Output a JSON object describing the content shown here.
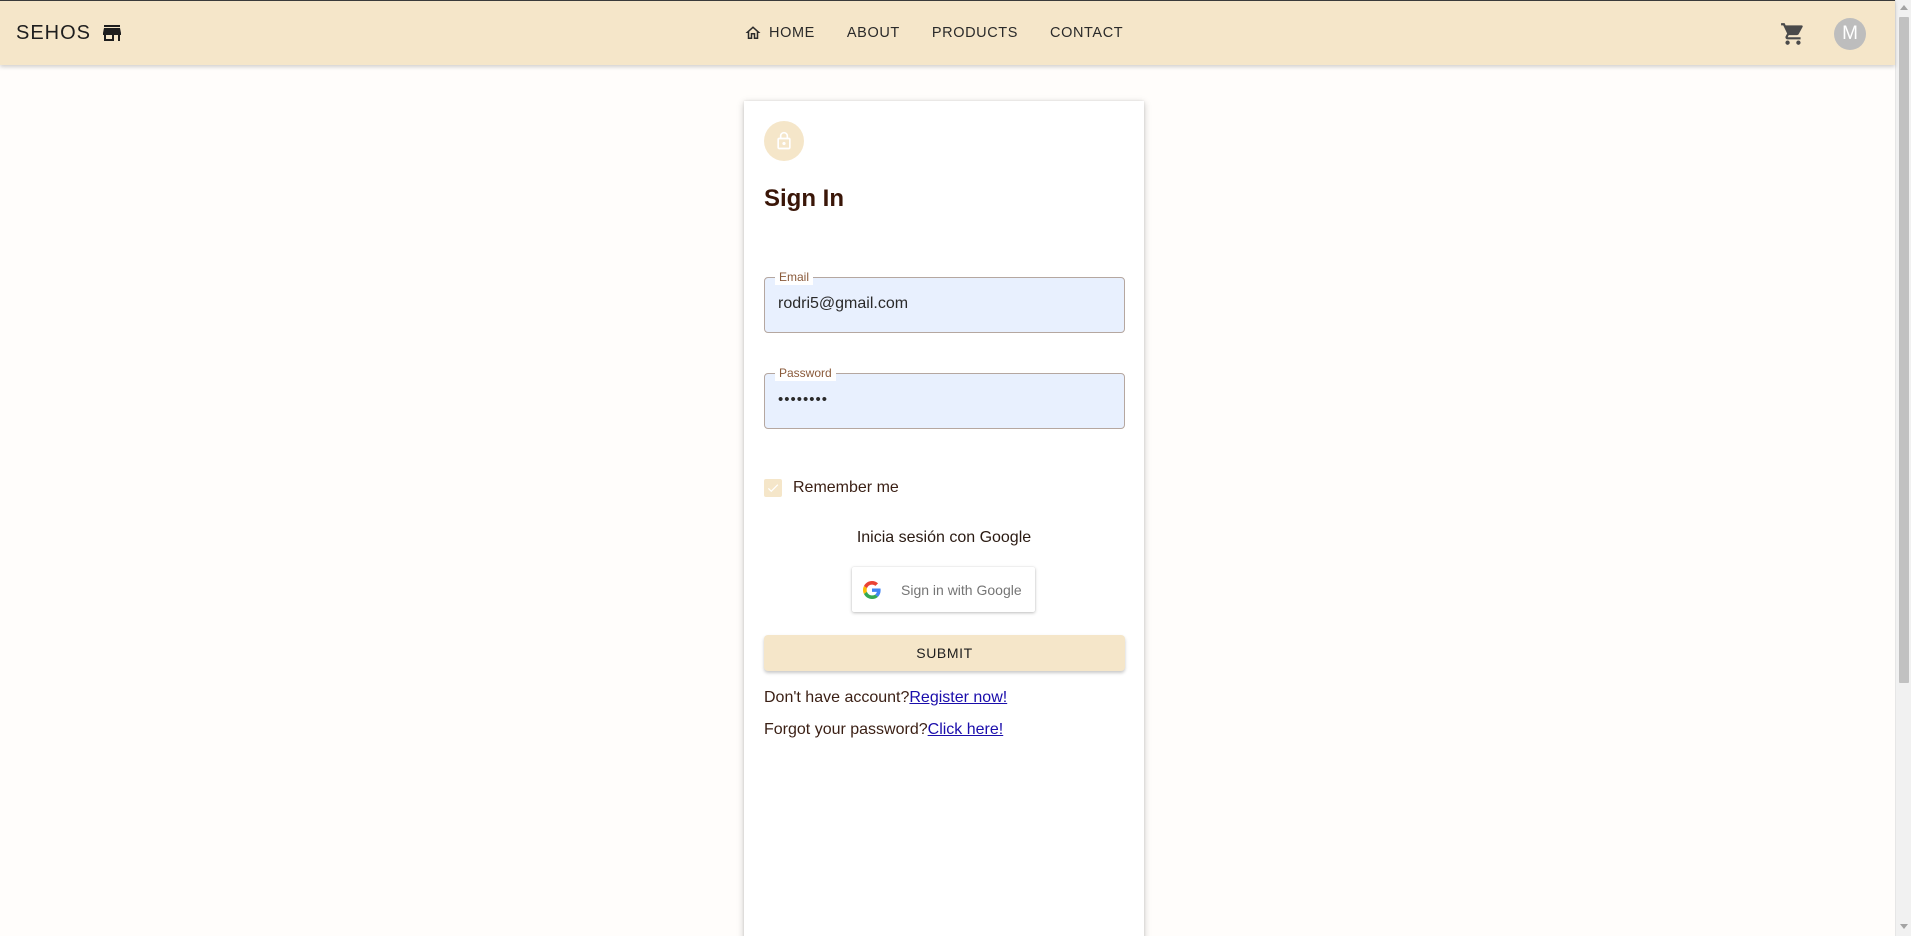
{
  "appbar": {
    "brand": "SEHOS",
    "nav": [
      "HOME",
      "ABOUT",
      "PRODUCTS",
      "CONTACT"
    ],
    "avatar_initial": "M",
    "background": "#f5e6c9"
  },
  "signin": {
    "title": "Sign In",
    "email": {
      "label": "Email",
      "value": "rodri5@gmail.com"
    },
    "password": {
      "label": "Password",
      "value": "••••••••"
    },
    "remember_label": "Remember me",
    "remember_checked": true,
    "google_caption": "Inicia sesión con Google",
    "google_button": "Sign in with Google",
    "submit_label": "SUBMIT",
    "register_prompt": "Don't have account?",
    "register_link": "Register now!",
    "forgot_prompt": "Forgot your password?",
    "forgot_link": "Click here!"
  },
  "icons": {
    "brand": "storefront-icon",
    "home": "home-icon",
    "cart": "shopping-cart-icon",
    "lock": "lock-icon",
    "check": "check-icon",
    "google": "google-logo-icon"
  },
  "colors": {
    "accent": "#f5e6c9",
    "title": "#3a1608",
    "link": "#1a0dab",
    "input_fill": "#e8f0fe"
  }
}
